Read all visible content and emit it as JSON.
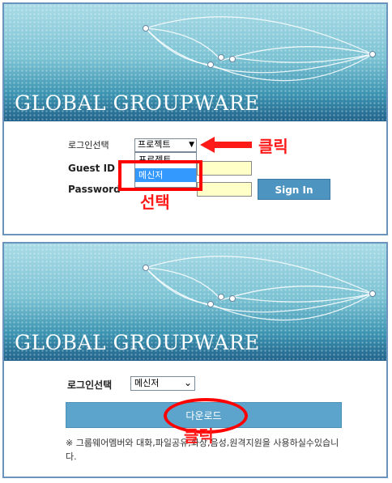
{
  "top_panel": {
    "banner_title": "GLOBAL GROUPWARE",
    "login_select_label": "로그인선택",
    "login_select_value": "프로젝트",
    "dropdown_options": [
      "프로젝트",
      "메신저"
    ],
    "dropdown_selected": "메신저",
    "guest_id_label": "Guest ID",
    "password_label": "Password",
    "signin_label": "Sign In",
    "annotation_click": "클릭",
    "annotation_select": "선택"
  },
  "bottom_panel": {
    "banner_title": "GLOBAL GROUPWARE",
    "login_select_label": "로그인선택",
    "login_select_value": "메신저",
    "download_label": "다운로드",
    "notice": "※ 그룹웨어멤버와 대화,파일공유,화상,음성,원격지원을 사용하실수있습니다.",
    "annotation_click": "클릭"
  },
  "colors": {
    "annotation": "#ff0000",
    "button": "#4d95c0",
    "input_bg": "#ffffc8",
    "frame": "#6a93bd"
  }
}
